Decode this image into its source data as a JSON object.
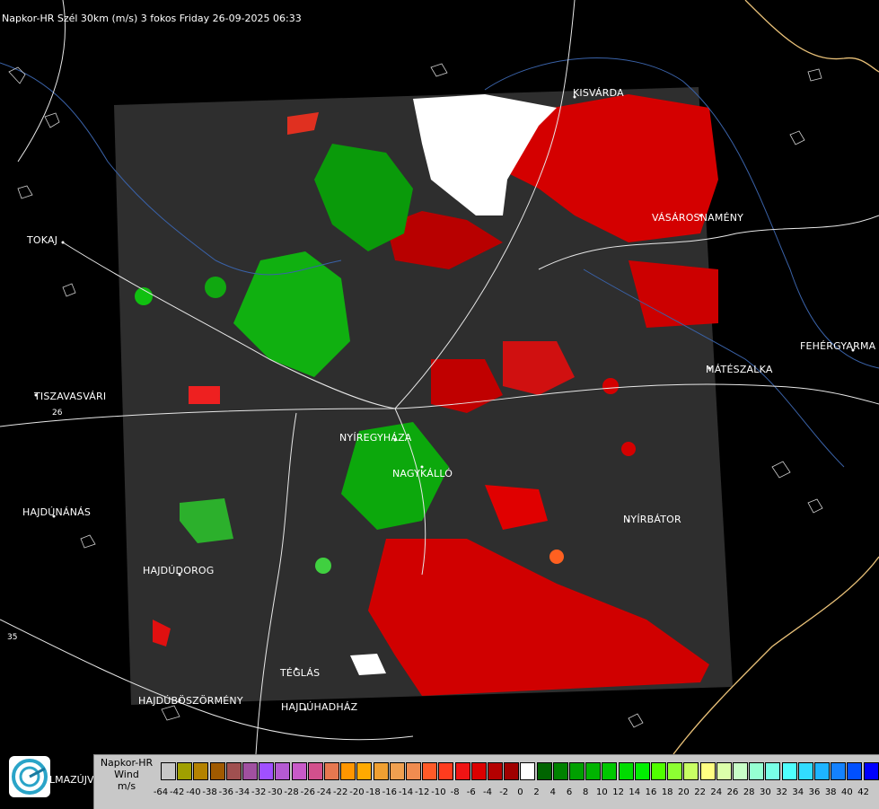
{
  "title": "Napkor-HR Szél 30km (m/s) 3 fokos Friday 26-09-2025 06:33",
  "cities": [
    {
      "name": "KISVÁRDA"
    },
    {
      "name": "TOKAJ"
    },
    {
      "name": "VÁSÁROSNAMÉNY"
    },
    {
      "name": "FEHÉRGYARMA"
    },
    {
      "name": "MÁTÉSZALKA"
    },
    {
      "name": "TISZAVASVÁRI"
    },
    {
      "name": "NYÍREGYHÁZA"
    },
    {
      "name": "NAGYKÁLLÓ"
    },
    {
      "name": "HAJDÚNÁNÁS"
    },
    {
      "name": "NYÍRBÁTOR"
    },
    {
      "name": "HAJDÚDOROG"
    },
    {
      "name": "TÉGLÁS"
    },
    {
      "name": "HAJDÚBÖSZÖRMÉNY"
    },
    {
      "name": "HAJDÚHADHÁZ"
    }
  ],
  "road_numbers": {
    "r26": "26",
    "r35": "35"
  },
  "legend": {
    "line1": "Napkor-HR",
    "line2": "Wind",
    "line3": "m/s",
    "ticks": [
      "-64",
      "-42",
      "-40",
      "-38",
      "-36",
      "-34",
      "-32",
      "-30",
      "-28",
      "-26",
      "-24",
      "-22",
      "-20",
      "-18",
      "-16",
      "-14",
      "-12",
      "-10",
      "-8",
      "-6",
      "-4",
      "-2",
      "0",
      "2",
      "4",
      "6",
      "8",
      "10",
      "12",
      "14",
      "16",
      "18",
      "20",
      "22",
      "24",
      "26",
      "28",
      "30",
      "32",
      "34",
      "36",
      "38",
      "40",
      "42"
    ],
    "colors": [
      "#c8c8c8",
      "#a0a000",
      "#b48200",
      "#a05a00",
      "#a05050",
      "#a050a0",
      "#a050ff",
      "#b45ad2",
      "#c85ac8",
      "#d2508c",
      "#e67850",
      "#ff9600",
      "#ffaa00",
      "#f0a032",
      "#f0a050",
      "#f08c50",
      "#ff5a28",
      "#ff3c1e",
      "#f01414",
      "#dc0000",
      "#b40000",
      "#a00000",
      "#ffffff",
      "#006400",
      "#008200",
      "#00a000",
      "#00b400",
      "#00c800",
      "#00dc00",
      "#00f000",
      "#50ff00",
      "#8cff32",
      "#c8ff64",
      "#ffff82",
      "#dcffaa",
      "#c8ffc8",
      "#96ffd2",
      "#78ffe6",
      "#50ffff",
      "#32dcff",
      "#1eb4ff",
      "#1482ff",
      "#0050ff",
      "#0000ff"
    ]
  },
  "logo_text": "LMAZÚJVÁR"
}
